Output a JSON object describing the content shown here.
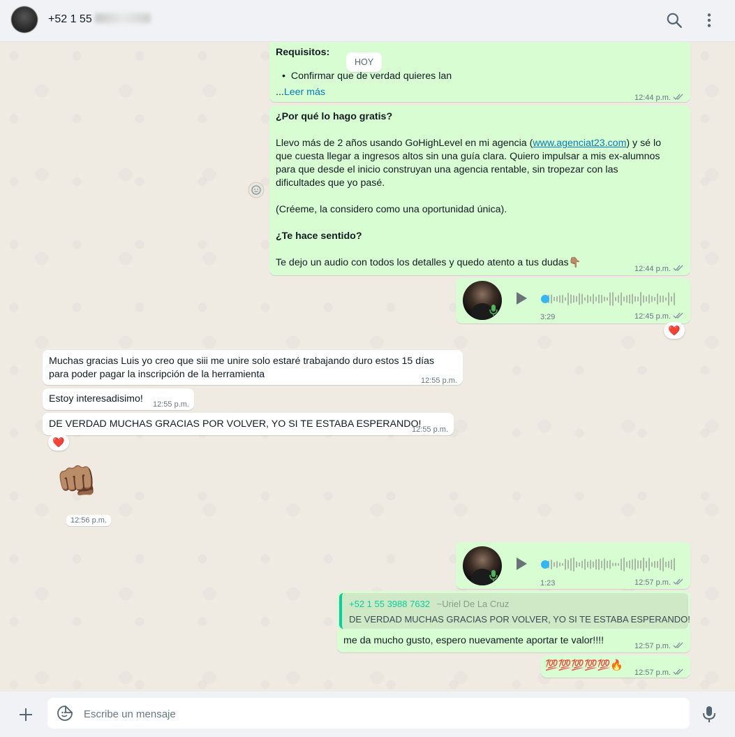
{
  "header": {
    "contact_name": "+52 1 55",
    "search_icon": "search-icon",
    "menu_icon": "kebab-menu-icon"
  },
  "chat": {
    "day_chip": "HOY",
    "msg1": {
      "title": "Requisitos:",
      "bullet": "Confirmar que de verdad quieres lan",
      "more_prefix": "...",
      "more": "Leer más",
      "time": "12:44 p.m."
    },
    "msg2": {
      "heading1": "¿Por qué lo hago gratis?",
      "p1_a": "Llevo más de 2 años usando GoHighLevel en mi agencia (",
      "p1_link": "www.agenciat23.com",
      "p1_b": ") y sé lo",
      "p1_line2": "que cuesta llegar a ingresos altos sin una guía clara. Quiero impulsar a mis ex-alumnos",
      "p1_line3": "para que desde el inicio construyan una agencia rentable, sin tropezar con las",
      "p1_line4": "dificultades que yo pasé.",
      "p2": "(Créeme, la considero como una oportunidad única).",
      "heading2": "¿Te hace sentido?",
      "p3": "Te dejo un audio con todos los detalles y quedo atento a tus dudas👇🏽",
      "time": "12:44 p.m."
    },
    "audio1": {
      "duration": "3:29",
      "time": "12:45 p.m.",
      "reaction": "❤️",
      "progress": 0
    },
    "in1": {
      "line1": "Muchas gracias Luis yo creo que siii me unire solo estaré trabajando duro estos 15 días",
      "line2": "para poder pagar la inscripción de la herramienta",
      "time": "12:55 p.m."
    },
    "in2": {
      "text": "Estoy interesadisimo!",
      "time": "12:55 p.m."
    },
    "in3": {
      "text": "DE VERDAD MUCHAS GRACIAS POR VOLVER, YO SI TE ESTABA ESPERANDO!",
      "time": "12:55 p.m.",
      "reaction": "❤️"
    },
    "sticker": {
      "emoji": "👊🏽",
      "time": "12:56 p.m."
    },
    "audio2": {
      "duration": "1:23",
      "time": "12:57 p.m.",
      "progress": 0
    },
    "reply": {
      "quoted_number": "+52 1 55 3988 7632",
      "quoted_name": "~Uriel De La Cruz",
      "quoted_text": "DE VERDAD MUCHAS GRACIAS POR VOLVER, YO SI TE ESTABA ESPERANDO!",
      "text": "me da mucho gusto, espero nuevamente aportar te valor!!!!",
      "time": "12:57 p.m."
    },
    "emoji_msg": {
      "text": "💯💯💯💯💯🔥",
      "time": "12:57 p.m."
    }
  },
  "footer": {
    "placeholder": "Escribe un mensaje",
    "attach_icon": "plus-icon",
    "sticker_icon": "sticker-icon",
    "mic_icon": "microphone-icon"
  },
  "colors": {
    "outgoing_bubble": "#d9fdd3",
    "incoming_bubble": "#ffffff",
    "chat_background": "#efeae2",
    "link": "#027eb5",
    "quote_accent": "#06cf9c",
    "read_ticks": "#8696a0"
  }
}
